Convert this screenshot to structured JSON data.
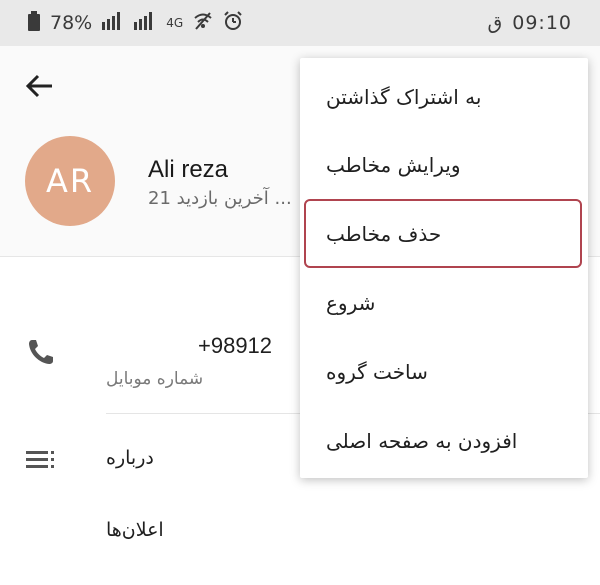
{
  "status_bar": {
    "time": "09:10",
    "time_suffix": "ق",
    "battery": "78%",
    "battery_icon": "battery-icon",
    "signal_icon": "signal-icon",
    "data_label": "4G",
    "wifi_icon": "wifi-icon",
    "alarm_icon": "alarm-icon"
  },
  "header": {
    "avatar_initials": "AR",
    "name": "Ali reza",
    "last_seen": "آخرین بازدید 21 ..."
  },
  "contact": {
    "phone": "+98912",
    "phone_label": "شماره موبایل",
    "bio_label": "درباره",
    "notifications_label": "اعلان‌ها"
  },
  "menu": {
    "items": [
      {
        "label": "به اشتراک گذاشتن"
      },
      {
        "label": "ویرایش مخاطب"
      },
      {
        "label": "حذف مخاطب"
      },
      {
        "label": "شروع"
      },
      {
        "label": "ساخت گروه"
      },
      {
        "label": "افزودن به صفحه اصلی"
      }
    ]
  },
  "colors": {
    "avatar": "#e2a98a",
    "highlight": "#b0444f",
    "status_bar": "#e9e9e9"
  }
}
